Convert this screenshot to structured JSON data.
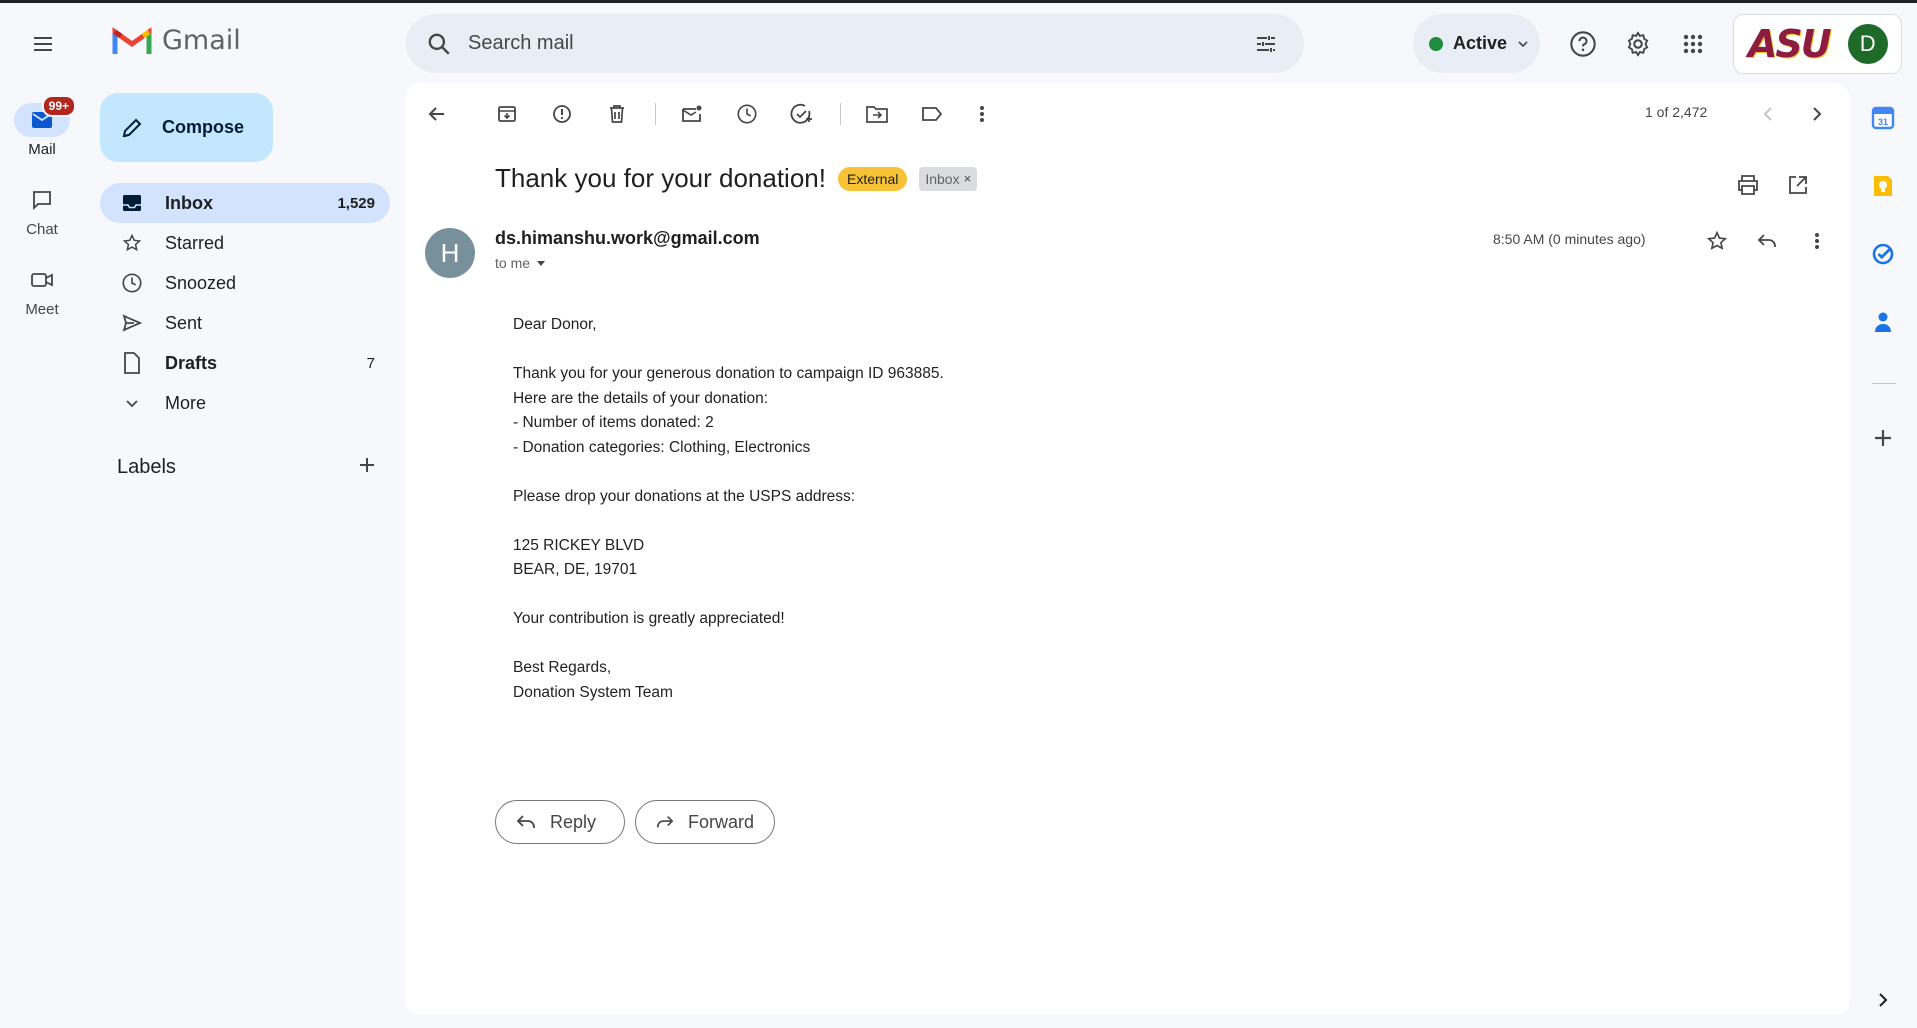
{
  "app": {
    "name": "Gmail",
    "search_placeholder": "Search mail",
    "status_label": "Active",
    "account_initial": "D",
    "org_logo_text": "ASU"
  },
  "rail": {
    "items": [
      {
        "label": "Mail",
        "badge": "99+",
        "icon": "mail-icon"
      },
      {
        "label": "Chat",
        "icon": "chat-icon"
      },
      {
        "label": "Meet",
        "icon": "video-icon"
      }
    ]
  },
  "sidebar": {
    "compose_label": "Compose",
    "items": [
      {
        "label": "Inbox",
        "count": "1,529",
        "icon": "inbox-icon"
      },
      {
        "label": "Starred",
        "count": "",
        "icon": "star-icon"
      },
      {
        "label": "Snoozed",
        "count": "",
        "icon": "clock-icon"
      },
      {
        "label": "Sent",
        "count": "",
        "icon": "send-icon"
      },
      {
        "label": "Drafts",
        "count": "7",
        "icon": "draft-icon"
      },
      {
        "label": "More",
        "count": "",
        "icon": "chevron-down-icon"
      }
    ],
    "labels_title": "Labels"
  },
  "toolbar": {
    "pager": "1 of 2,472"
  },
  "email": {
    "subject": "Thank you for your donation!",
    "tags": {
      "external": "External",
      "inbox": "Inbox"
    },
    "sender_initial": "H",
    "sender": "ds.himanshu.work@gmail.com",
    "to": "to me",
    "time": "8:50 AM (0 minutes ago)",
    "body_lines": [
      "Dear Donor,",
      "",
      "Thank you for your generous donation to campaign ID 963885.",
      "Here are the details of your donation:",
      "- Number of items donated: 2",
      "- Donation categories: Clothing, Electronics",
      "",
      "Please drop your donations at the USPS address:",
      "",
      "125 RICKEY BLVD",
      "BEAR, DE, 19701",
      "",
      "Your contribution is greatly appreciated!",
      "",
      "Best Regards,",
      "Donation System Team"
    ],
    "reply_label": "Reply",
    "forward_label": "Forward"
  },
  "colors": {
    "background": "#f6f8fc",
    "selected": "#d3e3fd",
    "compose": "#c2e7ff",
    "external_tag": "#f7c235",
    "status_green": "#1e8e3e",
    "badge_red": "#b3261e"
  }
}
